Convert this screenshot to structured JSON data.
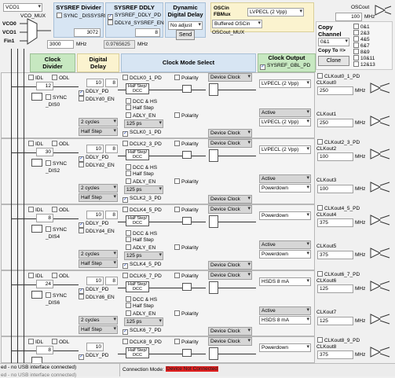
{
  "top": {
    "vco_select": "VCO1",
    "vco_mux_label": "VCO_MUX",
    "vco0": "VCO0",
    "vco1": "VCO1",
    "fin1": "Fin1",
    "vco_freq": "3000",
    "vco_unit": "MHz",
    "sysref_divider_title": "SYSREF Divider",
    "sync_dissysref": "SYNC _DISSYSREF",
    "sysref_div_value": "3072",
    "sysref_freq": "0.9765625",
    "sysref_freq_unit": "MHz",
    "sysref_ddly_title": "SYSREF DDLY",
    "sysref_ddly_pd": "SYSREF_DDLY_PD",
    "ddlyd_sysref_en": "DDLYd_SYSREF_EN",
    "sysref_ddly_value": "8",
    "dyn_delay_title": "Dynamic Digital Delay",
    "dyn_delay_select": "No adjust",
    "send_label": "Send",
    "oscin_label": "OSCin FBMux",
    "oscin_format": "LVPECL (2 Vpp)",
    "osc_buffered": "Buffered OSCin",
    "oscout_mux": "OSCout_MUX",
    "oscout_label": "OSCout",
    "oscout_freq": "100",
    "oscout_unit": "MHz",
    "copy_channel_title": "Copy Channel",
    "copy_channel_select": "0&1",
    "copy_to_label": "Copy To =>",
    "clone_label": "Clone",
    "copy_targets": [
      {
        "label": "0&1",
        "checked": false
      },
      {
        "label": "2&3",
        "checked": false
      },
      {
        "label": "4&5",
        "checked": false
      },
      {
        "label": "6&7",
        "checked": false
      },
      {
        "label": "8&9",
        "checked": false
      },
      {
        "label": "10&11",
        "checked": false
      },
      {
        "label": "12&13",
        "checked": false
      }
    ]
  },
  "headers": {
    "clock_divider": "Clock Divider",
    "digital_delay": "Digital Delay",
    "clock_mode_select": "Clock Mode Select",
    "clock_output": "Clock Output",
    "sysref_gbl_pd": "SYSREF_GBL_PD"
  },
  "rows": [
    {
      "idl": "IDL",
      "odl": "ODL",
      "div": "12",
      "sync": "SYNC _DIS0",
      "ddly_pd": "DDLY_PD",
      "ddly_en": "DDLYd0_EN",
      "ddly_val": "10",
      "ddly_val2": "8",
      "cycles": "2 cycles",
      "half": "Half Step",
      "dclk_pd": "DCLK0_1_PD",
      "polarity": "Polarity",
      "mode1": "Device Clock",
      "dcc_hs": "DCC & HS",
      "half_step": "Half Step",
      "adly_en": "ADLY_EN",
      "adly_val": "125 ps",
      "sclk_pd": "SCLK0_1_PD",
      "polarity2": "Polarity",
      "mode2": "Device Clock",
      "fmt1": "LVPECL (2 Vpp)",
      "fmt2": "LVPECL (2 Vpp)",
      "state": "Active",
      "cout_pd": "CLKout0_1_PD",
      "cout_a": "CLKout0",
      "freq_a": "250",
      "cout_b": "CLKout1",
      "freq_b": "250",
      "unit": "MHz"
    },
    {
      "idl": "IDL",
      "odl": "ODL",
      "div": "30",
      "sync": "SYNC _DIS2",
      "ddly_pd": "DDLY_PD",
      "ddly_en": "DDLYd2_EN",
      "ddly_val": "10",
      "ddly_val2": "8",
      "cycles": "2 cycles",
      "half": "Half Step",
      "dclk_pd": "DCLK2_3_PD",
      "polarity": "Polarity",
      "mode1": "Device Clock",
      "dcc_hs": "DCC & HS",
      "half_step": "Half Step",
      "adly_en": "ADLY_EN",
      "adly_val": "125 ps",
      "sclk_pd": "SCLK2_3_PD",
      "polarity2": "Polarity",
      "mode2": "Device Clock",
      "fmt1": "LVPECL (2 Vpp)",
      "fmt2": "Powerdown",
      "state": "Active",
      "cout_pd": "CLKout2_3_PD",
      "cout_a": "CLKout2",
      "freq_a": "100",
      "cout_b": "CLKout3",
      "freq_b": "100",
      "unit": "MHz"
    },
    {
      "idl": "IDL",
      "odl": "ODL",
      "div": "8",
      "sync": "SYNC _DIS4",
      "ddly_pd": "DDLY_PD",
      "ddly_en": "DDLYd4_EN",
      "ddly_val": "10",
      "ddly_val2": "8",
      "cycles": "2 cycles",
      "half": "Half Step",
      "dclk_pd": "DCLK4_5_PD",
      "polarity": "Polarity",
      "mode1": "Device Clock",
      "dcc_hs": "DCC & HS",
      "half_step": "Half Step",
      "adly_en": "ADLY_EN",
      "adly_val": "125 ps",
      "sclk_pd": "SCLK4_5_PD",
      "polarity2": "Polarity",
      "mode2": "Device Clock",
      "fmt1": "Powerdown",
      "fmt2": "Powerdown",
      "state": "Active",
      "cout_pd": "CLKout4_5_PD",
      "cout_a": "CLKout4",
      "freq_a": "375",
      "cout_b": "CLKout5",
      "freq_b": "375",
      "unit": "MHz"
    },
    {
      "idl": "IDL",
      "odl": "ODL",
      "div": "24",
      "sync": "SYNC _DIS6",
      "ddly_pd": "DDLY_PD",
      "ddly_en": "DDLYd6_EN",
      "ddly_val": "10",
      "ddly_val2": "8",
      "cycles": "2 cycles",
      "half": "Half Step",
      "dclk_pd": "DCLK6_7_PD",
      "polarity": "Polarity",
      "mode1": "Device Clock",
      "dcc_hs": "DCC & HS",
      "half_step": "Half Step",
      "adly_en": "ADLY_EN",
      "adly_val": "125 ps",
      "sclk_pd": "SCLK6_7_PD",
      "polarity2": "Polarity",
      "mode2": "Device Clock",
      "fmt1": "HSDS 8 mA",
      "fmt2": "HSDS 8 mA",
      "state": "Active",
      "cout_pd": "CLKout6_7_PD",
      "cout_a": "CLKout6",
      "freq_a": "125",
      "cout_b": "CLKout7",
      "freq_b": "125",
      "unit": "MHz"
    },
    {
      "idl": "IDL",
      "odl": "ODL",
      "div": "8",
      "sync": "",
      "ddly_pd": "DDLY_PD",
      "ddly_en": "",
      "ddly_val": "10",
      "ddly_val2": "",
      "cycles": "",
      "half": "",
      "dclk_pd": "DCLK8_9_PD",
      "polarity": "Polarity",
      "mode1": "Device Clock",
      "dcc_hs": "",
      "half_step": "",
      "adly_en": "",
      "adly_val": "",
      "sclk_pd": "",
      "polarity2": "",
      "mode2": "",
      "fmt1": "Powerdown",
      "fmt2": "",
      "state": "",
      "cout_pd": "CLKout8_9_PD",
      "cout_a": "CLKout8",
      "freq_a": "375",
      "cout_b": "",
      "freq_b": "",
      "unit": "MHz"
    }
  ],
  "statusbar": {
    "left1": "ed - no USB interface connected)",
    "left2": "ed - no USB interface connected)",
    "mode_label": "Connection Mode:",
    "mode_value": "Device Not Connected"
  },
  "colors": {
    "green_header": "#c7e8c1",
    "yellow_header": "#fbf3cf",
    "blue_header": "#d7e5f3",
    "status_red": "#e02020"
  }
}
